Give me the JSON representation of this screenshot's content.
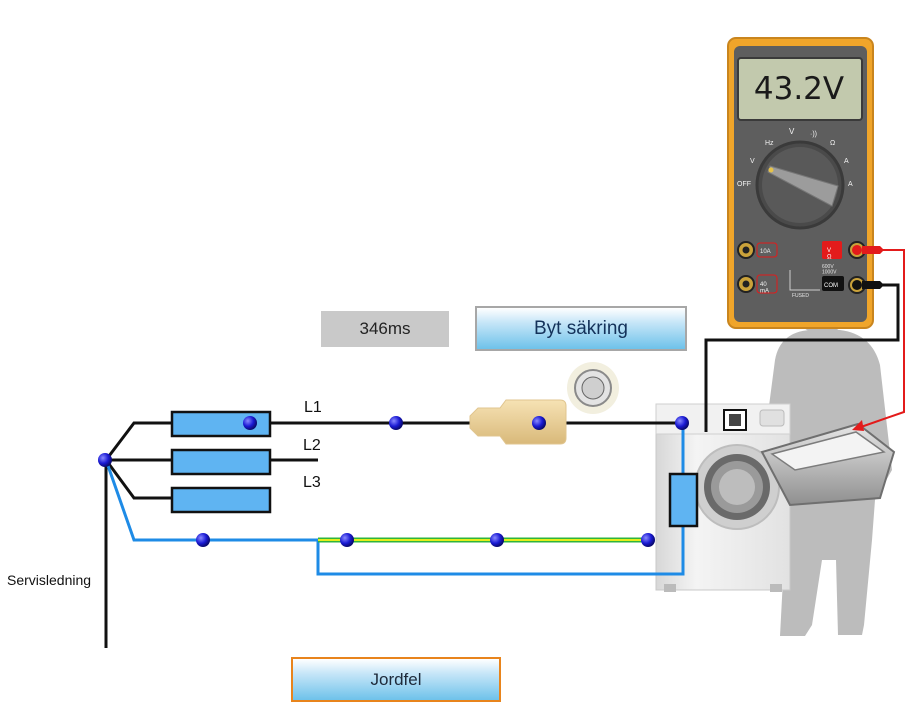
{
  "diagram": {
    "phase_labels": [
      "L1",
      "L2",
      "L3"
    ],
    "service_line_label": "Servisledning",
    "timer": "346ms",
    "buttons": {
      "replace_fuse": "Byt säkring",
      "earth_fault": "Jordfel"
    },
    "multimeter": {
      "reading": "43.2V",
      "dial_labels": {
        "off": "OFF",
        "v_ac": "V",
        "hz": "Hz",
        "v_dc": "V",
        "continuity": "·))",
        "ohm": "Ω",
        "a_ac": "A",
        "a_dc": "A"
      },
      "jacks": {
        "ten_a": "10A",
        "forty_ma": "40\nmA",
        "v_ohm": "V\nΩ",
        "com": "COM",
        "fused": "FUSED",
        "rating": "600V\n1000V"
      }
    },
    "colors": {
      "phase_wire": "#111111",
      "neutral_wire": "#1e8be6",
      "earth_wire_yellow": "#e6ec1a",
      "earth_wire_green": "#2fb43c",
      "fuse_fill": "#5fb4f2",
      "node": "#1a1ad4",
      "probe_red": "#e31b1b",
      "meter_body": "#f0a52a",
      "meter_panel": "#5e5e5e",
      "lcd": "#c2c9ad",
      "button_border_fuse": "#a7a7a7",
      "button_border_earth": "#e8841c"
    }
  }
}
